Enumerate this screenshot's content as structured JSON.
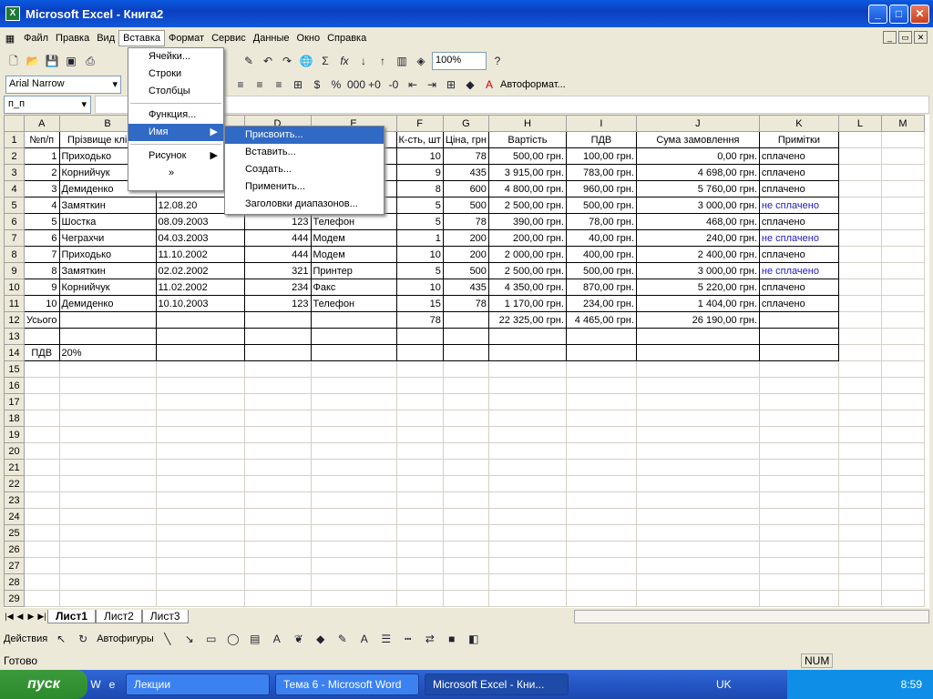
{
  "window": {
    "title": "Microsoft Excel - Книга2",
    "icon": "excel-icon"
  },
  "menubar": [
    "Файл",
    "Правка",
    "Вид",
    "Вставка",
    "Формат",
    "Сервис",
    "Данные",
    "Окно",
    "Справка"
  ],
  "toolbar": {
    "zoom": "100%",
    "font": "Arial Narrow",
    "autoformat": "Автоформат..."
  },
  "namebox": "п_п",
  "columns": [
    "A",
    "B",
    "C",
    "D",
    "E",
    "F",
    "G",
    "H",
    "I",
    "J",
    "K",
    "L",
    "M"
  ],
  "rows": [
    [
      "№п/п",
      "Прізвище клієнта",
      "",
      "",
      "",
      "К-сть, шт",
      "Ціна, грн",
      "Вартість",
      "ПДВ",
      "Сума замовлення",
      "Примітки"
    ],
    [
      "1",
      "Приходько",
      "",
      "",
      "",
      "10",
      "78",
      "500,00 грн.",
      "100,00 грн.",
      "0,00 грн.",
      "сплачено"
    ],
    [
      "2",
      "Корнийчук",
      "",
      "",
      "",
      "9",
      "435",
      "3 915,00 грн.",
      "783,00 грн.",
      "4 698,00 грн.",
      "сплачено"
    ],
    [
      "3",
      "Демиденко",
      "",
      "",
      "",
      "8",
      "600",
      "4 800,00 грн.",
      "960,00 грн.",
      "5 760,00 грн.",
      "сплачено"
    ],
    [
      "4",
      "Замяткин",
      "12.08.20",
      "",
      "",
      "5",
      "500",
      "2 500,00 грн.",
      "500,00 грн.",
      "3 000,00 грн.",
      "не сплачено"
    ],
    [
      "5",
      "Шостка",
      "08.09.2003",
      "123",
      "Телефон",
      "5",
      "78",
      "390,00 грн.",
      "78,00 грн.",
      "468,00 грн.",
      "сплачено"
    ],
    [
      "6",
      "Чеграхчи",
      "04.03.2003",
      "444",
      "Модем",
      "1",
      "200",
      "200,00 грн.",
      "40,00 грн.",
      "240,00 грн.",
      "не сплачено"
    ],
    [
      "7",
      "Приходько",
      "11.10.2002",
      "444",
      "Модем",
      "10",
      "200",
      "2 000,00 грн.",
      "400,00 грн.",
      "2 400,00 грн.",
      "сплачено"
    ],
    [
      "8",
      "Замяткин",
      "02.02.2002",
      "321",
      "Принтер",
      "5",
      "500",
      "2 500,00 грн.",
      "500,00 грн.",
      "3 000,00 грн.",
      "не сплачено"
    ],
    [
      "9",
      "Корнийчук",
      "11.02.2002",
      "234",
      "Факс",
      "10",
      "435",
      "4 350,00 грн.",
      "870,00 грн.",
      "5 220,00 грн.",
      "сплачено"
    ],
    [
      "10",
      "Демиденко",
      "10.10.2003",
      "123",
      "Телефон",
      "15",
      "78",
      "1 170,00 грн.",
      "234,00 грн.",
      "1 404,00 грн.",
      "сплачено"
    ],
    [
      "Усього",
      "",
      "",
      "",
      "",
      "78",
      "",
      "22 325,00 грн.",
      "4 465,00 грн.",
      "26 190,00 грн.",
      ""
    ],
    [
      "",
      "",
      "",
      "",
      "",
      "",
      "",
      "",
      "",
      "",
      ""
    ],
    [
      "ПДВ",
      "20%",
      "",
      "",
      "",
      "",
      "",
      "",
      "",
      "",
      ""
    ]
  ],
  "sheets": [
    "Лист1",
    "Лист2",
    "Лист3"
  ],
  "drawbar": {
    "actions": "Действия",
    "autoshapes": "Автофигуры"
  },
  "status": {
    "ready": "Готово",
    "num": "NUM"
  },
  "menu_insert": {
    "items": [
      "Ячейки...",
      "Строки",
      "Столбцы",
      "Функция...",
      "Имя",
      "Рисунок"
    ]
  },
  "menu_name": {
    "items": [
      "Присвоить...",
      "Вставить...",
      "Создать...",
      "Применить...",
      "Заголовки диапазонов..."
    ]
  },
  "taskbar": {
    "start": "пуск",
    "items": [
      "Лекции",
      "Тема 6 - Microsoft Word",
      "Microsoft Excel - Кни..."
    ],
    "lang": "UK",
    "time": "8:59"
  }
}
